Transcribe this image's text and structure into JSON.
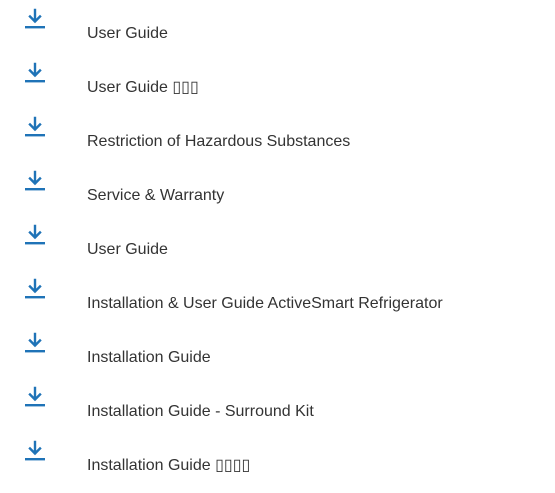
{
  "accent_color": "#1f73b7",
  "text_color": "#333333",
  "downloads": [
    {
      "label": "User Guide",
      "icon": "download-icon"
    },
    {
      "label": "User Guide ▯▯▯",
      "icon": "download-icon"
    },
    {
      "label": "Restriction of Hazardous Substances",
      "icon": "download-icon"
    },
    {
      "label": "Service & Warranty",
      "icon": "download-icon"
    },
    {
      "label": "User Guide",
      "icon": "download-icon"
    },
    {
      "label": "Installation & User Guide ActiveSmart Refrigerator",
      "icon": "download-icon"
    },
    {
      "label": "Installation Guide",
      "icon": "download-icon"
    },
    {
      "label": "Installation Guide - Surround Kit",
      "icon": "download-icon"
    },
    {
      "label": "Installation Guide ▯▯▯▯",
      "icon": "download-icon"
    }
  ]
}
